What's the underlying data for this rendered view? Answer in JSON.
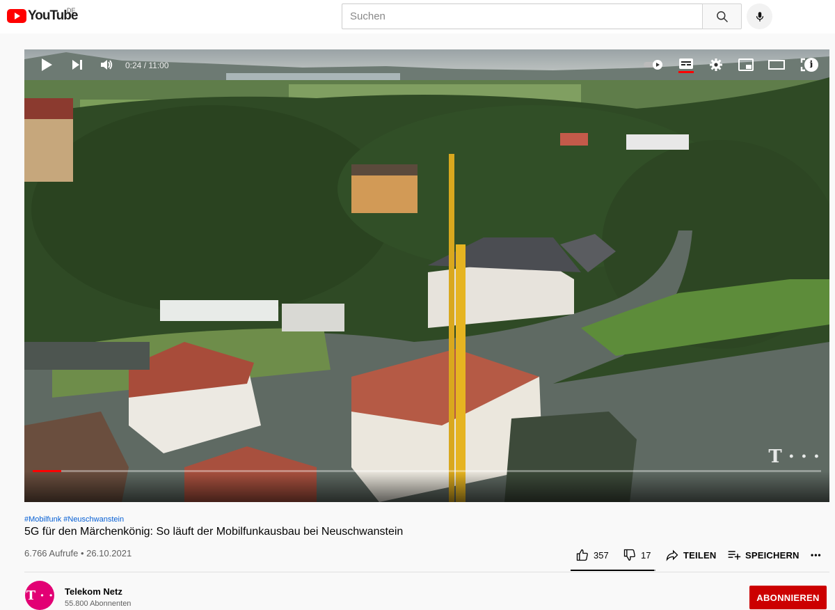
{
  "header": {
    "logo_text": "YouTube",
    "country_code": "DE",
    "search_placeholder": "Suchen"
  },
  "player": {
    "current_time": "0:24",
    "duration": "11:00",
    "time_display": "0:24 / 11:00",
    "progress_fraction": 0.036,
    "watermark": "T · · ·"
  },
  "video": {
    "hashtags": "#Mobilfunk #Neuschwanstein",
    "title": "5G für den Märchenkönig: So läuft der Mobilfunkausbau bei Neuschwanstein",
    "views_date": "6.766 Aufrufe • 26.10.2021"
  },
  "actions": {
    "likes": "357",
    "dislikes": "17",
    "share_label": "TEILEN",
    "save_label": "SPEICHERN",
    "more_label": "•••"
  },
  "channel": {
    "name": "Telekom Netz",
    "subscribers": "55.800 Abonnenten",
    "avatar_text": "T · ·",
    "subscribe_label": "ABONNIEREN"
  },
  "colors": {
    "brand_red": "#ff0000",
    "subscribe_red": "#cc0000",
    "telekom_magenta": "#e20074",
    "link_blue": "#065fd4"
  }
}
